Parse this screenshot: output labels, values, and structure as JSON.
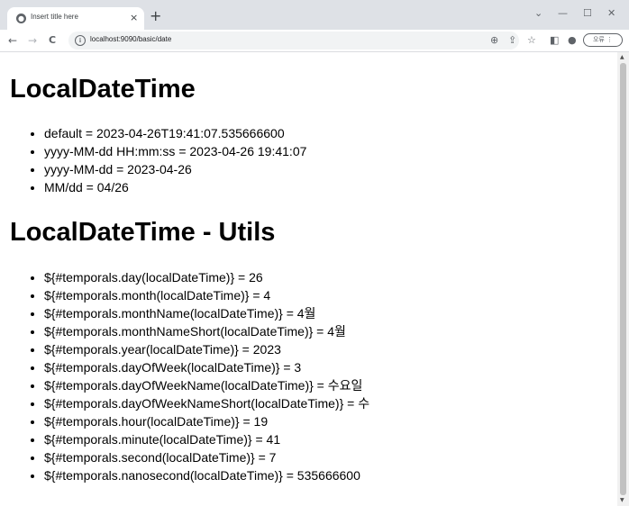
{
  "browser": {
    "tab_title": "Insert title here",
    "tab_close": "×",
    "new_tab": "+",
    "url": "localhost:9090/basic/date",
    "profile_label": "오류",
    "controls": {
      "dropdown": "⌄",
      "minimize": "—",
      "maximize": "☐",
      "close": "✕"
    },
    "nav": {
      "back": "←",
      "forward": "→",
      "reload": "C"
    }
  },
  "sections": [
    {
      "heading": "LocalDateTime",
      "items": [
        "default = 2023-04-26T19:41:07.535666600",
        "yyyy-MM-dd HH:mm:ss = 2023-04-26 19:41:07",
        "yyyy-MM-dd = 2023-04-26",
        "MM/dd = 04/26"
      ]
    },
    {
      "heading": "LocalDateTime - Utils",
      "items": [
        "${#temporals.day(localDateTime)} = 26",
        "${#temporals.month(localDateTime)} = 4",
        "${#temporals.monthName(localDateTime)} = 4월",
        "${#temporals.monthNameShort(localDateTime)} = 4월",
        "${#temporals.year(localDateTime)} = 2023",
        "${#temporals.dayOfWeek(localDateTime)} = 3",
        "${#temporals.dayOfWeekName(localDateTime)} = 수요일",
        "${#temporals.dayOfWeekNameShort(localDateTime)} = 수",
        "${#temporals.hour(localDateTime)} = 19",
        "${#temporals.minute(localDateTime)} = 41",
        "${#temporals.second(localDateTime)} = 7",
        "${#temporals.nanosecond(localDateTime)} = 535666600"
      ]
    }
  ]
}
